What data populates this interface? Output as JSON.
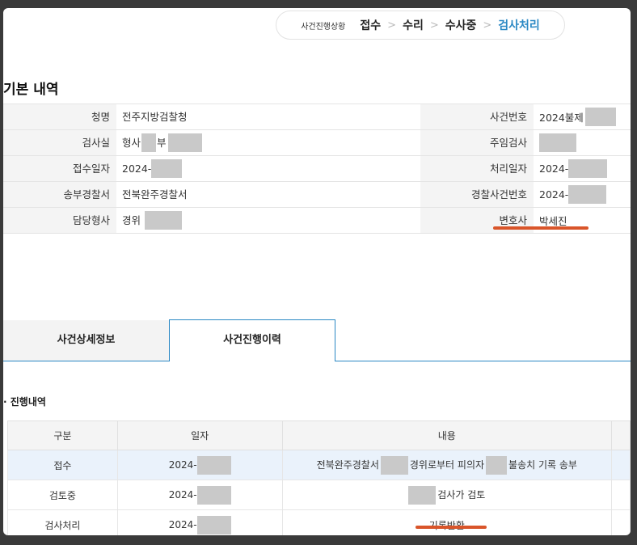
{
  "status": {
    "label": "사건진행상황",
    "steps": [
      "접수",
      "수리",
      "수사중",
      "검사처리"
    ],
    "current": "검사처리",
    "separator": ">"
  },
  "basic": {
    "title": "기본 내역",
    "rows": [
      {
        "k1": "청명",
        "v1": "전주지방검찰청",
        "k2": "사건번호",
        "v2": "2024불제"
      },
      {
        "k1": "검사실",
        "v1a": "형사",
        "v1b": "부",
        "k2": "주임검사",
        "v2": ""
      },
      {
        "k1": "접수일자",
        "v1": "2024-",
        "k2": "처리일자",
        "v2": "2024-"
      },
      {
        "k1": "송부경찰서",
        "v1": "전북완주경찰서",
        "k2": "경찰사건번호",
        "v2": "2024-"
      },
      {
        "k1": "담당형사",
        "v1": "경위",
        "k2": "변호사",
        "v2": "박세진"
      }
    ]
  },
  "tabs": [
    {
      "label": "사건상세정보"
    },
    {
      "label": "사건진행이력"
    }
  ],
  "progress": {
    "title": "· 진행내역",
    "headers": [
      "구분",
      "일자",
      "내용"
    ],
    "rows": [
      {
        "type": "접수",
        "date": "2024-",
        "c1": "전북완주경찰서",
        "c2": "경위로부터 피의자",
        "c3": "불송치 기록 송부"
      },
      {
        "type": "검토중",
        "date": "2024-",
        "c2": "검사가 검토"
      },
      {
        "type": "검사처리",
        "date": "2024-",
        "c1": "기록반환"
      }
    ]
  },
  "colors": {
    "accent": "#2a88c4",
    "highlight_underline": "#d9552a"
  }
}
